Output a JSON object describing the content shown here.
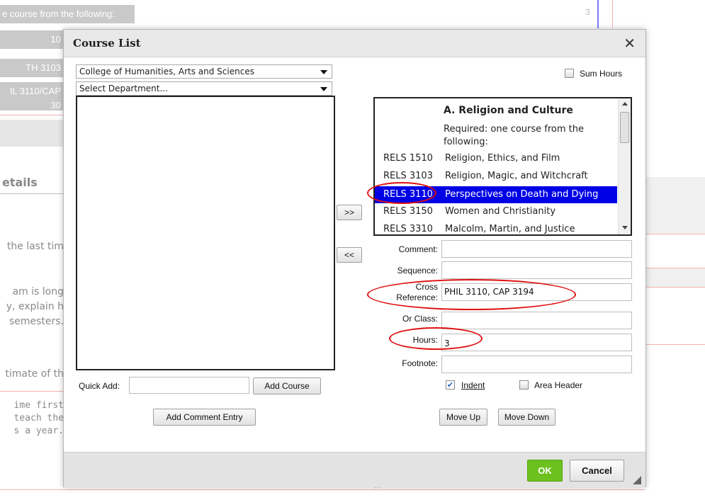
{
  "background": {
    "top_strip_text": "e course from the following:",
    "top_strip_right": "3",
    "strip_items": [
      "10",
      "TH 3103",
      "IL 3110/CAP",
      "30"
    ],
    "section_heading": "etails",
    "text_lines": [
      "the last tim",
      "am is long",
      "y, explain h",
      "semesters.",
      "timate of th"
    ],
    "mono_lines": [
      "ime first",
      "teach the",
      "s a year."
    ]
  },
  "dialog": {
    "title": "Course List",
    "close_icon": "close-icon",
    "college_select": "College of Humanities, Arts and Sciences",
    "department_select": "Select Department...",
    "sum_hours_label": "Sum Hours",
    "add_button": ">>",
    "remove_button": "<<",
    "quick_add_label": "Quick Add:",
    "quick_add_value": "",
    "add_course_button": "Add Course",
    "add_comment_button": "Add Comment Entry",
    "course_list": {
      "header": "A. Religion and Culture",
      "note": "Required: one course from the following:",
      "rows": [
        {
          "code": "RELS 1510",
          "name": "Religion, Ethics, and Film",
          "selected": false
        },
        {
          "code": "RELS 3103",
          "name": "Religion, Magic, and Witchcraft",
          "selected": false
        },
        {
          "code": "RELS 3110",
          "name": "Perspectives on Death and Dying",
          "selected": true
        },
        {
          "code": "RELS 3150",
          "name": "Women and Christianity",
          "selected": false
        },
        {
          "code": "RELS 3310",
          "name": "Malcolm, Martin, and Justice",
          "selected": false
        }
      ]
    },
    "fields": {
      "comment_label": "Comment:",
      "comment_value": "",
      "sequence_label": "Sequence:",
      "sequence_value": "",
      "cross_reference_label_1": "Cross",
      "cross_reference_label_2": "Reference:",
      "cross_reference_value": "PHIL 3110, CAP 3194",
      "or_class_label": "Or Class:",
      "or_class_value": "",
      "hours_label": "Hours:",
      "hours_value": "3",
      "footnote_label": "Footnote:",
      "footnote_value": ""
    },
    "indent_label": "Indent",
    "indent_checked": true,
    "area_header_label": "Area Header",
    "area_header_checked": false,
    "move_up_button": "Move Up",
    "move_down_button": "Move Down",
    "ok_button": "OK",
    "cancel_button": "Cancel",
    "colors": {
      "ok_green": "#6cc11f",
      "selection_blue": "#0000e6",
      "annotation_red": "#e01010"
    }
  }
}
